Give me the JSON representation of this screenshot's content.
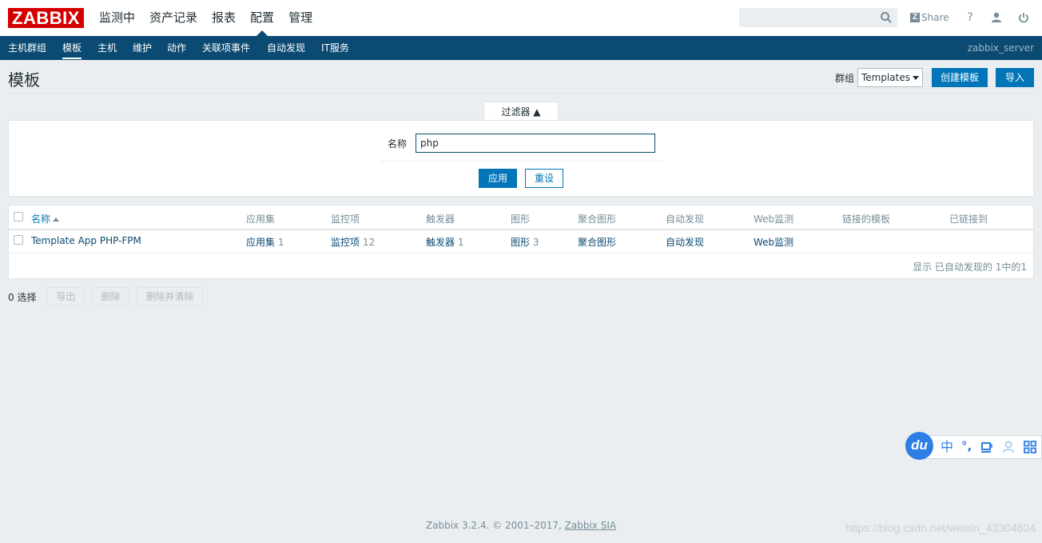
{
  "brand": {
    "logo": "ZABBIX"
  },
  "main_menu": [
    "监测中",
    "资产记录",
    "报表",
    "配置",
    "管理"
  ],
  "main_menu_active": "配置",
  "top_right": {
    "search_value": "",
    "share_label": "Share",
    "help": "?"
  },
  "subnav": {
    "items": [
      "主机群组",
      "模板",
      "主机",
      "维护",
      "动作",
      "关联项事件",
      "自动发现",
      "IT服务"
    ],
    "active": "模板",
    "server_name": "zabbix_server"
  },
  "header": {
    "title": "模板",
    "group_label": "群组",
    "group_selected": "Templates",
    "create_button": "创建模板",
    "import_button": "导入"
  },
  "filter": {
    "tab_label": "过滤器 ▲",
    "name_label": "名称",
    "name_value": "php",
    "apply_button": "应用",
    "reset_button": "重设"
  },
  "table": {
    "columns": [
      "名称",
      "应用集",
      "监控项",
      "触发器",
      "图形",
      "聚合图形",
      "自动发现",
      "Web监测",
      "链接的模板",
      "已链接到"
    ],
    "rows": [
      {
        "name": "Template App PHP-FPM",
        "applications": "应用集",
        "applications_count": "1",
        "items": "监控项",
        "items_count": "12",
        "triggers": "触发器",
        "triggers_count": "1",
        "graphs": "图形",
        "graphs_count": "3",
        "screens": "聚合图形",
        "discovery": "自动发现",
        "web": "Web监测",
        "linked_templates": "",
        "linked_to": ""
      }
    ],
    "paging": "显示 已自动发现的 1中的1"
  },
  "actions": {
    "selected": "0 选择",
    "export_button": "导出",
    "delete_button": "删除",
    "delete_clear_button": "删除并清除"
  },
  "footer": {
    "text": "Zabbix 3.2.4. © 2001–2017, ",
    "link": "Zabbix SIA"
  },
  "watermark": "https://blog.csdn.net/weixin_43304804",
  "ime": {
    "logo": "du",
    "lang": "中",
    "punct": "°,"
  },
  "colors": {
    "brand_red": "#d40000",
    "nav_blue": "#0b4a72",
    "button_blue": "#0275b8",
    "background": "#ebeef0"
  }
}
